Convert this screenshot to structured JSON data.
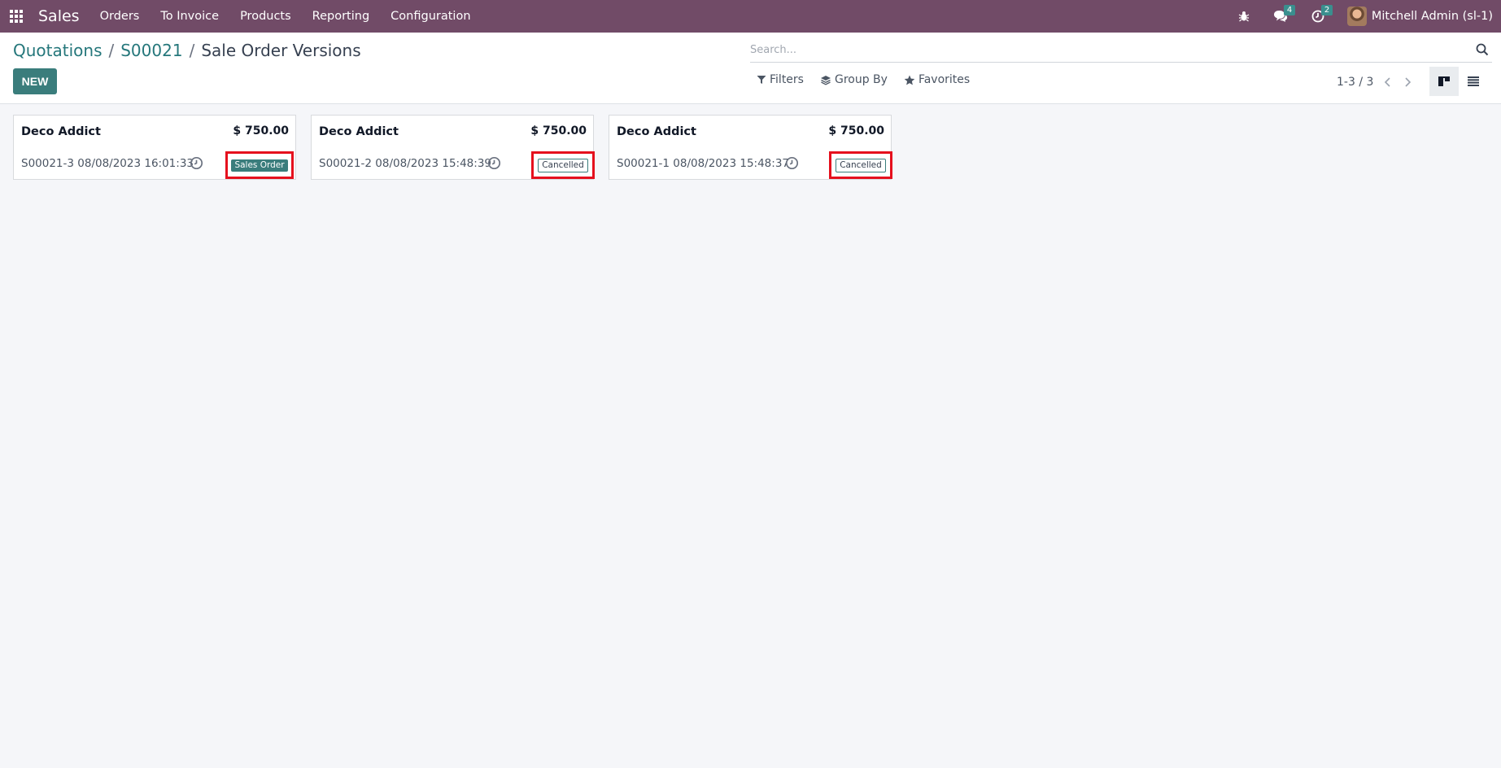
{
  "navbar": {
    "app_name": "Sales",
    "menu": [
      "Orders",
      "To Invoice",
      "Products",
      "Reporting",
      "Configuration"
    ],
    "messages_count": "4",
    "activities_count": "2",
    "user_name": "Mitchell Admin (sl-1)"
  },
  "breadcrumb": {
    "items": [
      "Quotations",
      "S00021"
    ],
    "current": "Sale Order Versions"
  },
  "toolbar": {
    "new_label": "NEW",
    "filters_label": "Filters",
    "group_by_label": "Group By",
    "favorites_label": "Favorites"
  },
  "search": {
    "placeholder": "Search..."
  },
  "pager": {
    "text": "1-3 / 3"
  },
  "colors": {
    "navbar": "#714b67",
    "primary": "#3a7d7c",
    "highlight": "#e5101d"
  },
  "cards": [
    {
      "customer": "Deco Addict",
      "amount": "$ 750.00",
      "reference": "S00021-3 08/08/2023 16:01:33",
      "status": "Sales Order"
    },
    {
      "customer": "Deco Addict",
      "amount": "$ 750.00",
      "reference": "S00021-2 08/08/2023 15:48:39",
      "status": "Cancelled"
    },
    {
      "customer": "Deco Addict",
      "amount": "$ 750.00",
      "reference": "S00021-1 08/08/2023 15:48:37",
      "status": "Cancelled"
    }
  ]
}
